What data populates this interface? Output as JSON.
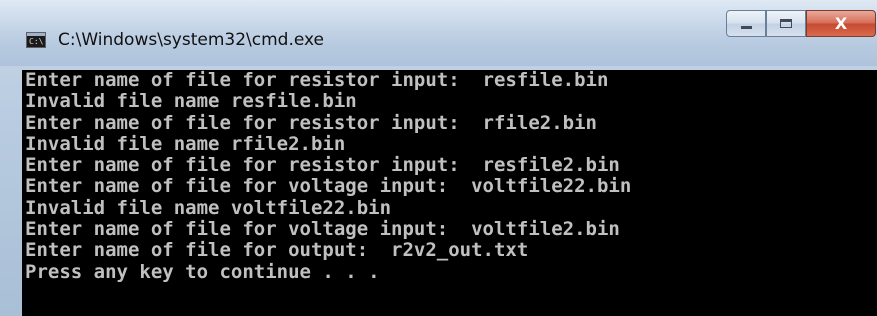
{
  "window": {
    "title": "C:\\Windows\\system32\\cmd.exe",
    "icon": "cmd-icon",
    "icon_text": "C:\\",
    "buttons": {
      "minimize_icon": "minimize-icon",
      "maximize_icon": "maximize-icon",
      "close_icon": "close-icon",
      "close_glyph": "X"
    }
  },
  "console": {
    "background_color": "#000000",
    "text_color": "#c0c0c0",
    "lines": [
      "Enter name of file for resistor input:  resfile.bin",
      "Invalid file name resfile.bin",
      "Enter name of file for resistor input:  rfile2.bin",
      "Invalid file name rfile2.bin",
      "Enter name of file for resistor input:  resfile2.bin",
      "Enter name of file for voltage input:  voltfile22.bin",
      "Invalid file name voltfile22.bin",
      "Enter name of file for voltage input:  voltfile2.bin",
      "Enter name of file for output:  r2v2_out.txt",
      "Press any key to continue . . ."
    ]
  }
}
